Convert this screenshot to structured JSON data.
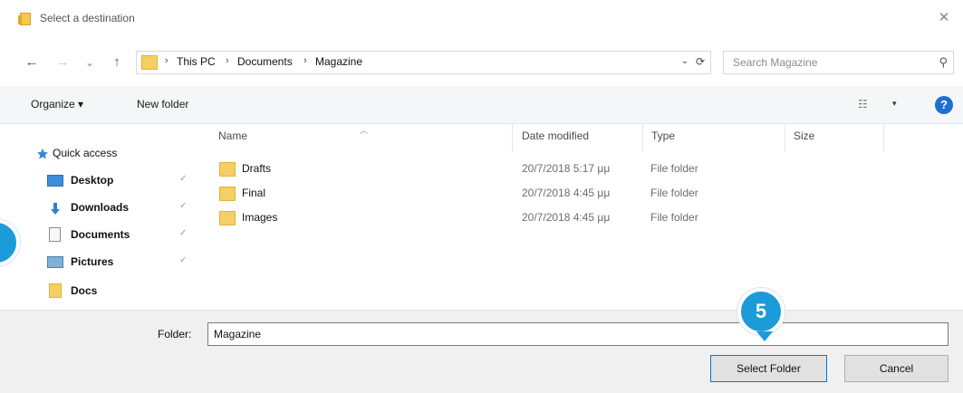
{
  "window": {
    "title": "Select a destination",
    "close_glyph": "✕"
  },
  "address": {
    "back_glyph": "←",
    "forward_glyph": "→",
    "recent_glyph": "⌄",
    "up_glyph": "↑",
    "crumbs": [
      "This PC",
      "Documents",
      "Magazine"
    ],
    "crumb_sep": "›",
    "dropdown_glyph": "⌄",
    "refresh_glyph": "⟳",
    "search_placeholder": "Search Magazine",
    "search_glyph": "⚲"
  },
  "toolbar": {
    "organize": "Organize ▾",
    "new_folder": "New folder",
    "view_glyph": "☷",
    "view_caret": "▾",
    "help": "?"
  },
  "navigation": {
    "quick_access": "Quick access",
    "pin_glyph": "✓",
    "items": [
      {
        "label": "Desktop",
        "icon": "desktop-icon",
        "pinned": true
      },
      {
        "label": "Downloads",
        "icon": "download-icon",
        "pinned": true
      },
      {
        "label": "Documents",
        "icon": "documents-icon",
        "pinned": true
      },
      {
        "label": "Pictures",
        "icon": "pictures-icon",
        "pinned": true
      },
      {
        "label": "Docs",
        "icon": "folder-icon",
        "pinned": false
      }
    ]
  },
  "columns": {
    "name": "Name",
    "date": "Date modified",
    "type": "Type",
    "size": "Size"
  },
  "files": [
    {
      "name": "Drafts",
      "date": "20/7/2018 5:17 μμ",
      "type": "File folder"
    },
    {
      "name": "Final",
      "date": "20/7/2018 4:45 μμ",
      "type": "File folder"
    },
    {
      "name": "Images",
      "date": "20/7/2018 4:45 μμ",
      "type": "File folder"
    }
  ],
  "footer": {
    "folder_label": "Folder:",
    "folder_value": "Magazine",
    "select_button": "Select Folder",
    "cancel_button": "Cancel"
  },
  "callouts": {
    "step": "5"
  },
  "colors": {
    "accent": "#1b9bd7",
    "folder": "#f5cf63",
    "help": "#1f6fd1"
  }
}
